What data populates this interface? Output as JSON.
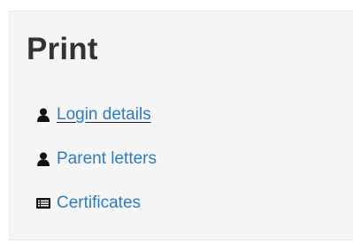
{
  "panel": {
    "title": "Print",
    "links": [
      {
        "label": " Login details",
        "icon": "user-icon",
        "underlined": true
      },
      {
        "label": "Parent letters",
        "icon": "user-icon",
        "underlined": false
      },
      {
        "label": "Certificates",
        "icon": "certificate-list-icon",
        "underlined": false
      }
    ]
  },
  "colors": {
    "link": "#2f7bbf",
    "title": "#333333",
    "panel_background": "#f5f5f5"
  }
}
